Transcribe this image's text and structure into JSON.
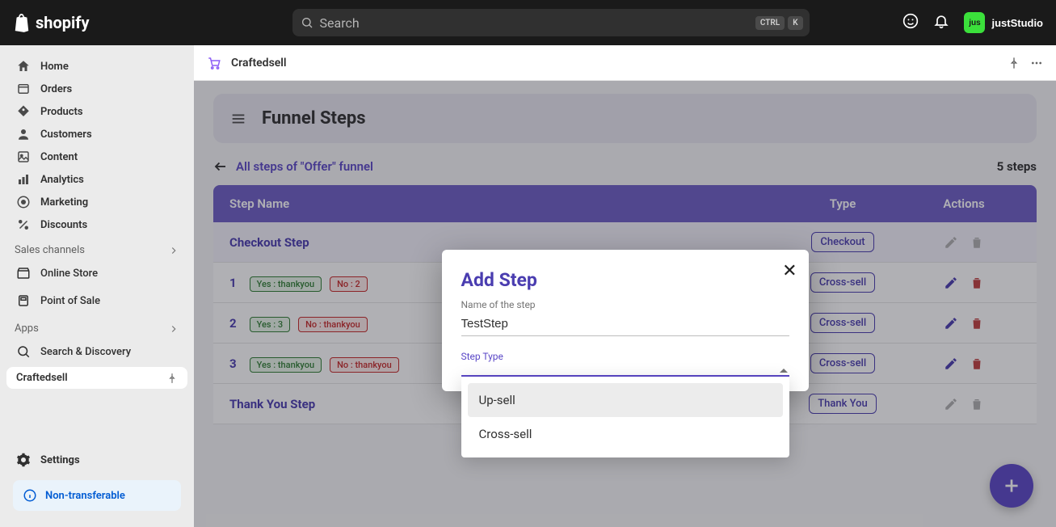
{
  "brand": "shopify",
  "search": {
    "placeholder": "Search",
    "kbd1": "CTRL",
    "kbd2": "K"
  },
  "user": {
    "avatar_txt": "jus",
    "name": "justStudio"
  },
  "nav": {
    "home": "Home",
    "orders": "Orders",
    "products": "Products",
    "customers": "Customers",
    "content": "Content",
    "analytics": "Analytics",
    "marketing": "Marketing",
    "discounts": "Discounts"
  },
  "sections": {
    "sales_channels": "Sales channels",
    "apps": "Apps"
  },
  "channels": {
    "online_store": "Online Store",
    "pos": "Point of Sale"
  },
  "apps": {
    "search_discovery": "Search & Discovery",
    "craftedsell": "Craftedsell"
  },
  "settings": "Settings",
  "non_transferable": "Non-transferable",
  "page": {
    "app_name": "Craftedsell"
  },
  "panel": {
    "title": "Funnel Steps"
  },
  "breadcrumb": "All steps of \"Offer\" funnel",
  "step_count": "5 steps",
  "columns": {
    "name": "Step Name",
    "type": "Type",
    "actions": "Actions"
  },
  "rows": [
    {
      "name": "Checkout Step",
      "type": "Checkout",
      "editable": false
    },
    {
      "idx": "1",
      "yes": "Yes : thankyou",
      "no": "No : 2",
      "type": "Cross-sell",
      "editable": true
    },
    {
      "idx": "2",
      "yes": "Yes : 3",
      "no": "No : thankyou",
      "type": "Cross-sell",
      "editable": true
    },
    {
      "idx": "3",
      "yes": "Yes : thankyou",
      "no": "No : thankyou",
      "type": "Cross-sell",
      "editable": true
    },
    {
      "name": "Thank You Step",
      "type": "Thank You",
      "editable": false
    }
  ],
  "modal": {
    "title": "Add Step",
    "name_label": "Name of the step",
    "name_value": "TestStep",
    "type_label": "Step Type",
    "options": [
      "Up-sell",
      "Cross-sell"
    ]
  }
}
